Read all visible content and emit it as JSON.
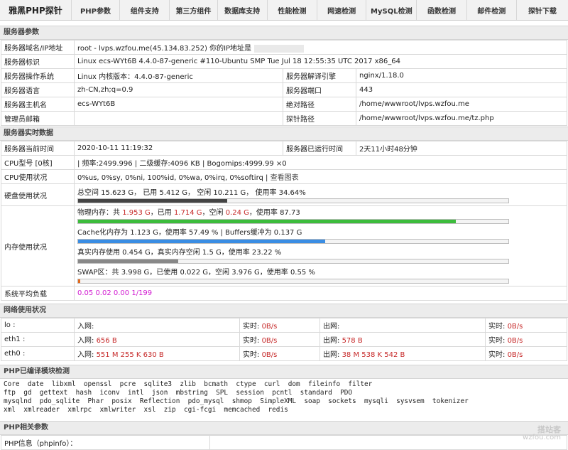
{
  "nav": {
    "brand": "雅黑PHP探针",
    "items": [
      "PHP参数",
      "组件支持",
      "第三方组件",
      "数据库支持",
      "性能检测",
      "网速检测",
      "MySQL检测",
      "函数检测",
      "邮件检测",
      "探针下载"
    ]
  },
  "server_params": {
    "title": "服务器参数",
    "domain_label": "服务器域名/IP地址",
    "domain_value": "root - lvps.wzfou.me(45.134.83.252)  你的IP地址是",
    "id_label": "服务器标识",
    "id_value": "Linux ecs-WYt6B 4.4.0-87-generic #110-Ubuntu SMP Tue Jul 18 12:55:35 UTC 2017 x86_64",
    "os_label": "服务器操作系统",
    "os_value": "Linux  内核版本：4.4.0-87-generic",
    "engine_label": "服务器解译引擎",
    "engine_value": "nginx/1.18.0",
    "lang_label": "服务器语言",
    "lang_value": "zh-CN,zh;q=0.9",
    "port_label": "服务器端口",
    "port_value": "443",
    "host_label": "服务器主机名",
    "host_value": "ecs-WYt6B",
    "abspath_label": "绝对路径",
    "abspath_value": "/home/wwwroot/lvps.wzfou.me",
    "admin_label": "管理员邮箱",
    "admin_value": "",
    "probepath_label": "探针路径",
    "probepath_value": "/home/wwwroot/lvps.wzfou.me/tz.php"
  },
  "realtime": {
    "title": "服务器实时数据",
    "time_label": "服务器当前时间",
    "time_value": "2020-10-11 11:19:32",
    "uptime_label": "服务器已运行时间",
    "uptime_value": "2天11小时48分钟",
    "cpu_label": "CPU型号 [0核]",
    "cpu_value": "| 频率:2499.996 | 二级缓存:4096 KB | Bogomips:4999.99 ×0",
    "cpuuse_label": "CPU使用状况",
    "cpuuse_value": "0%us, 0%sy, 0%ni, 100%id, 0%wa, 0%irq, 0%softirq",
    "cpuuse_link": "查看图表",
    "disk_label": "硬盘使用状况",
    "disk_text": "总空间 15.623 G，  已用 5.412 G，  空闲 10.211 G，  使用率 34.64%",
    "disk_pct": 34.64,
    "mem_label": "内存使用状况",
    "phys_prefix": "物理内存：共 ",
    "phys_total": "1.953 G",
    "phys_mid1": "，已用 ",
    "phys_used": "1.714 G",
    "phys_mid2": "，空闲 ",
    "phys_free": "0.24 G",
    "phys_suffix": "，使用率 87.73",
    "phys_pct": 87.73,
    "cache_text": "Cache化内存为 1.123 G，使用率 57.49 % | Buffers缓冲为 0.137 G",
    "cache_pct": 57.49,
    "real_text": "真实内存使用 0.454 G，真实内存空闲 1.5 G，使用率 23.22 %",
    "real_pct": 23.22,
    "swap_text": "SWAP区：共 3.998 G，已使用 0.022 G，空闲 3.976 G，使用率 0.55 %",
    "swap_pct": 0.55,
    "load_label": "系统平均负载",
    "load_value": "0.05 0.02 0.00 1/199",
    "colors": {
      "phys": "#3cbc3c",
      "cache": "#3a8de3",
      "real": "#888888",
      "swap": "#e06a1f",
      "disk": "#444444"
    }
  },
  "network": {
    "title": "网络使用状况",
    "rows": [
      {
        "iface": "lo :",
        "in_label": "入网:",
        "in_value": "",
        "rt_in_label": "实时:",
        "rt_in": "0B/s",
        "out_label": "出网:",
        "out_value": "",
        "rt_out_label": "实时:",
        "rt_out": "0B/s"
      },
      {
        "iface": "eth1 :",
        "in_label": "入网:",
        "in_value": "656 B",
        "rt_in_label": "实时:",
        "rt_in": "0B/s",
        "out_label": "出网:",
        "out_value": "578 B",
        "rt_out_label": "实时:",
        "rt_out": "0B/s"
      },
      {
        "iface": "eth0 :",
        "in_label": "入网:",
        "in_value": "551 M 255 K 630 B",
        "rt_in_label": "实时:",
        "rt_in": "0B/s",
        "out_label": "出网:",
        "out_value": "38 M 538 K 542 B",
        "rt_out_label": "实时:",
        "rt_out": "0B/s"
      }
    ]
  },
  "modules": {
    "title": "PHP已编译模块检测",
    "lines": [
      "Core  date  libxml  openssl  pcre  sqlite3  zlib  bcmath  ctype  curl  dom  fileinfo  filter",
      "ftp  gd  gettext  hash  iconv  intl  json  mbstring  SPL  session  pcntl  standard  PDO",
      "mysqlnd  pdo_sqlite  Phar  posix  Reflection  pdo_mysql  shmop  SimpleXML  soap  sockets  mysqli  sysvsem  tokenizer",
      "xml  xmlreader  xmlrpc  xmlwriter  xsl  zip  cgi-fcgi  memcached  redis"
    ]
  },
  "php_params": {
    "title": "PHP相关参数",
    "info_label": "PHP信息（phpinfo）："
  },
  "watermark": {
    "line1": "搭站客",
    "line2": "wzfou.com"
  }
}
